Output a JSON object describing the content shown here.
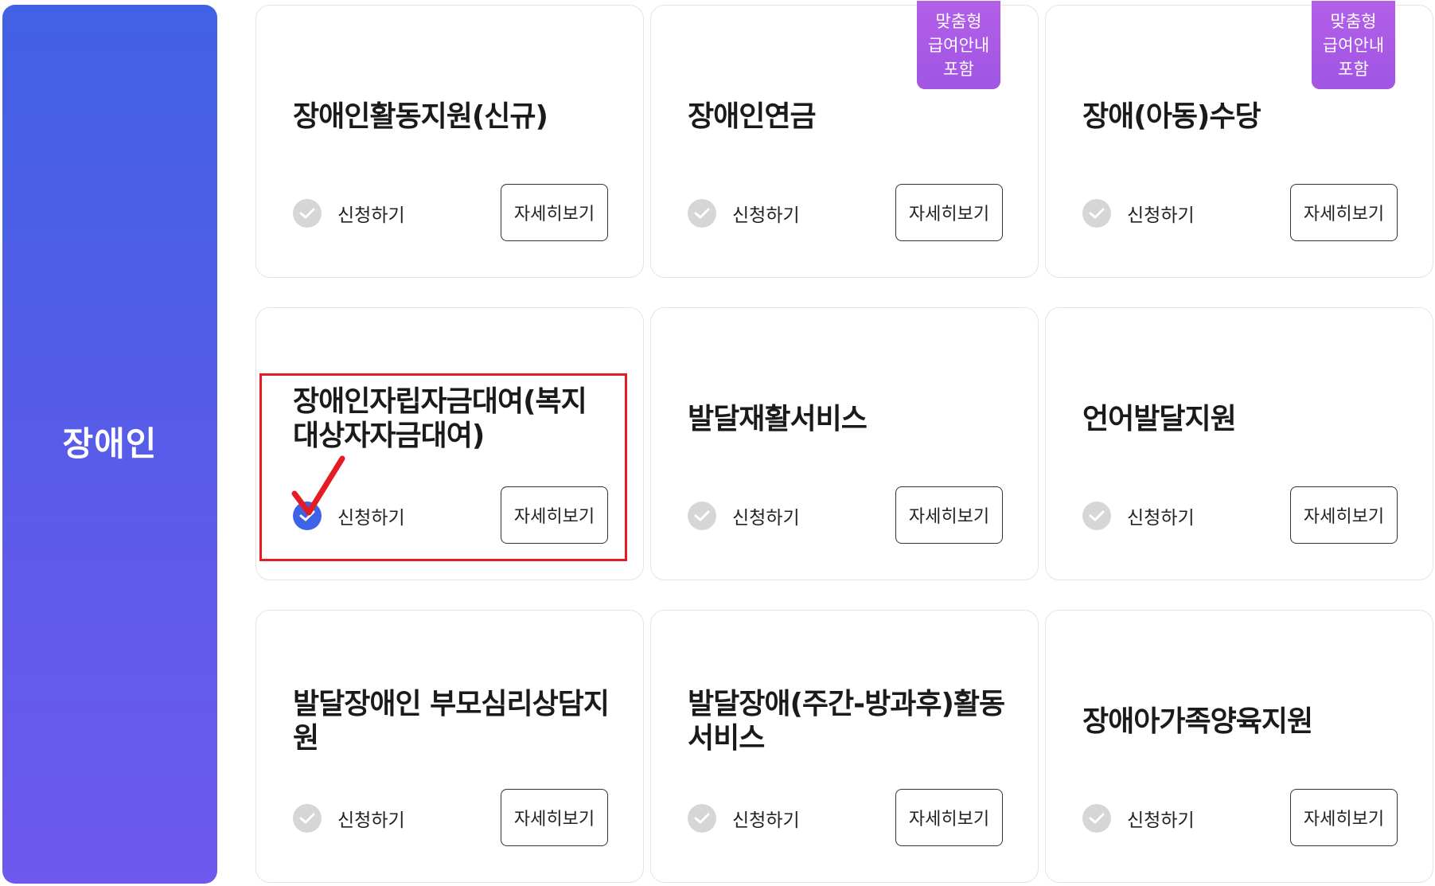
{
  "sidebar": {
    "title": "장애인"
  },
  "badge": {
    "line1": "맞춤형",
    "line2": "급여안내",
    "line3": "포함"
  },
  "common": {
    "apply_label": "신청하기",
    "detail_label": "자세히보기"
  },
  "cards": [
    {
      "title": "장애인활동지원(신규)",
      "badge": false,
      "checked": false
    },
    {
      "title": "장애인연금",
      "badge": true,
      "checked": false
    },
    {
      "title": "장애(아동)수당",
      "badge": true,
      "checked": false
    },
    {
      "title": "장애인자립자금대여(복지대상자자금대여)",
      "badge": false,
      "checked": true
    },
    {
      "title": "발달재활서비스",
      "badge": false,
      "checked": false
    },
    {
      "title": "언어발달지원",
      "badge": false,
      "checked": false
    },
    {
      "title": "발달장애인 부모심리상담지원",
      "badge": false,
      "checked": false
    },
    {
      "title": "발달장애(주간-방과후)활동서비스",
      "badge": false,
      "checked": false
    },
    {
      "title": "장애아가족양육지원",
      "badge": false,
      "checked": false
    }
  ],
  "colors": {
    "accent": "#3f63e6",
    "highlight": "#e41c23",
    "badge": "#a858e6"
  }
}
